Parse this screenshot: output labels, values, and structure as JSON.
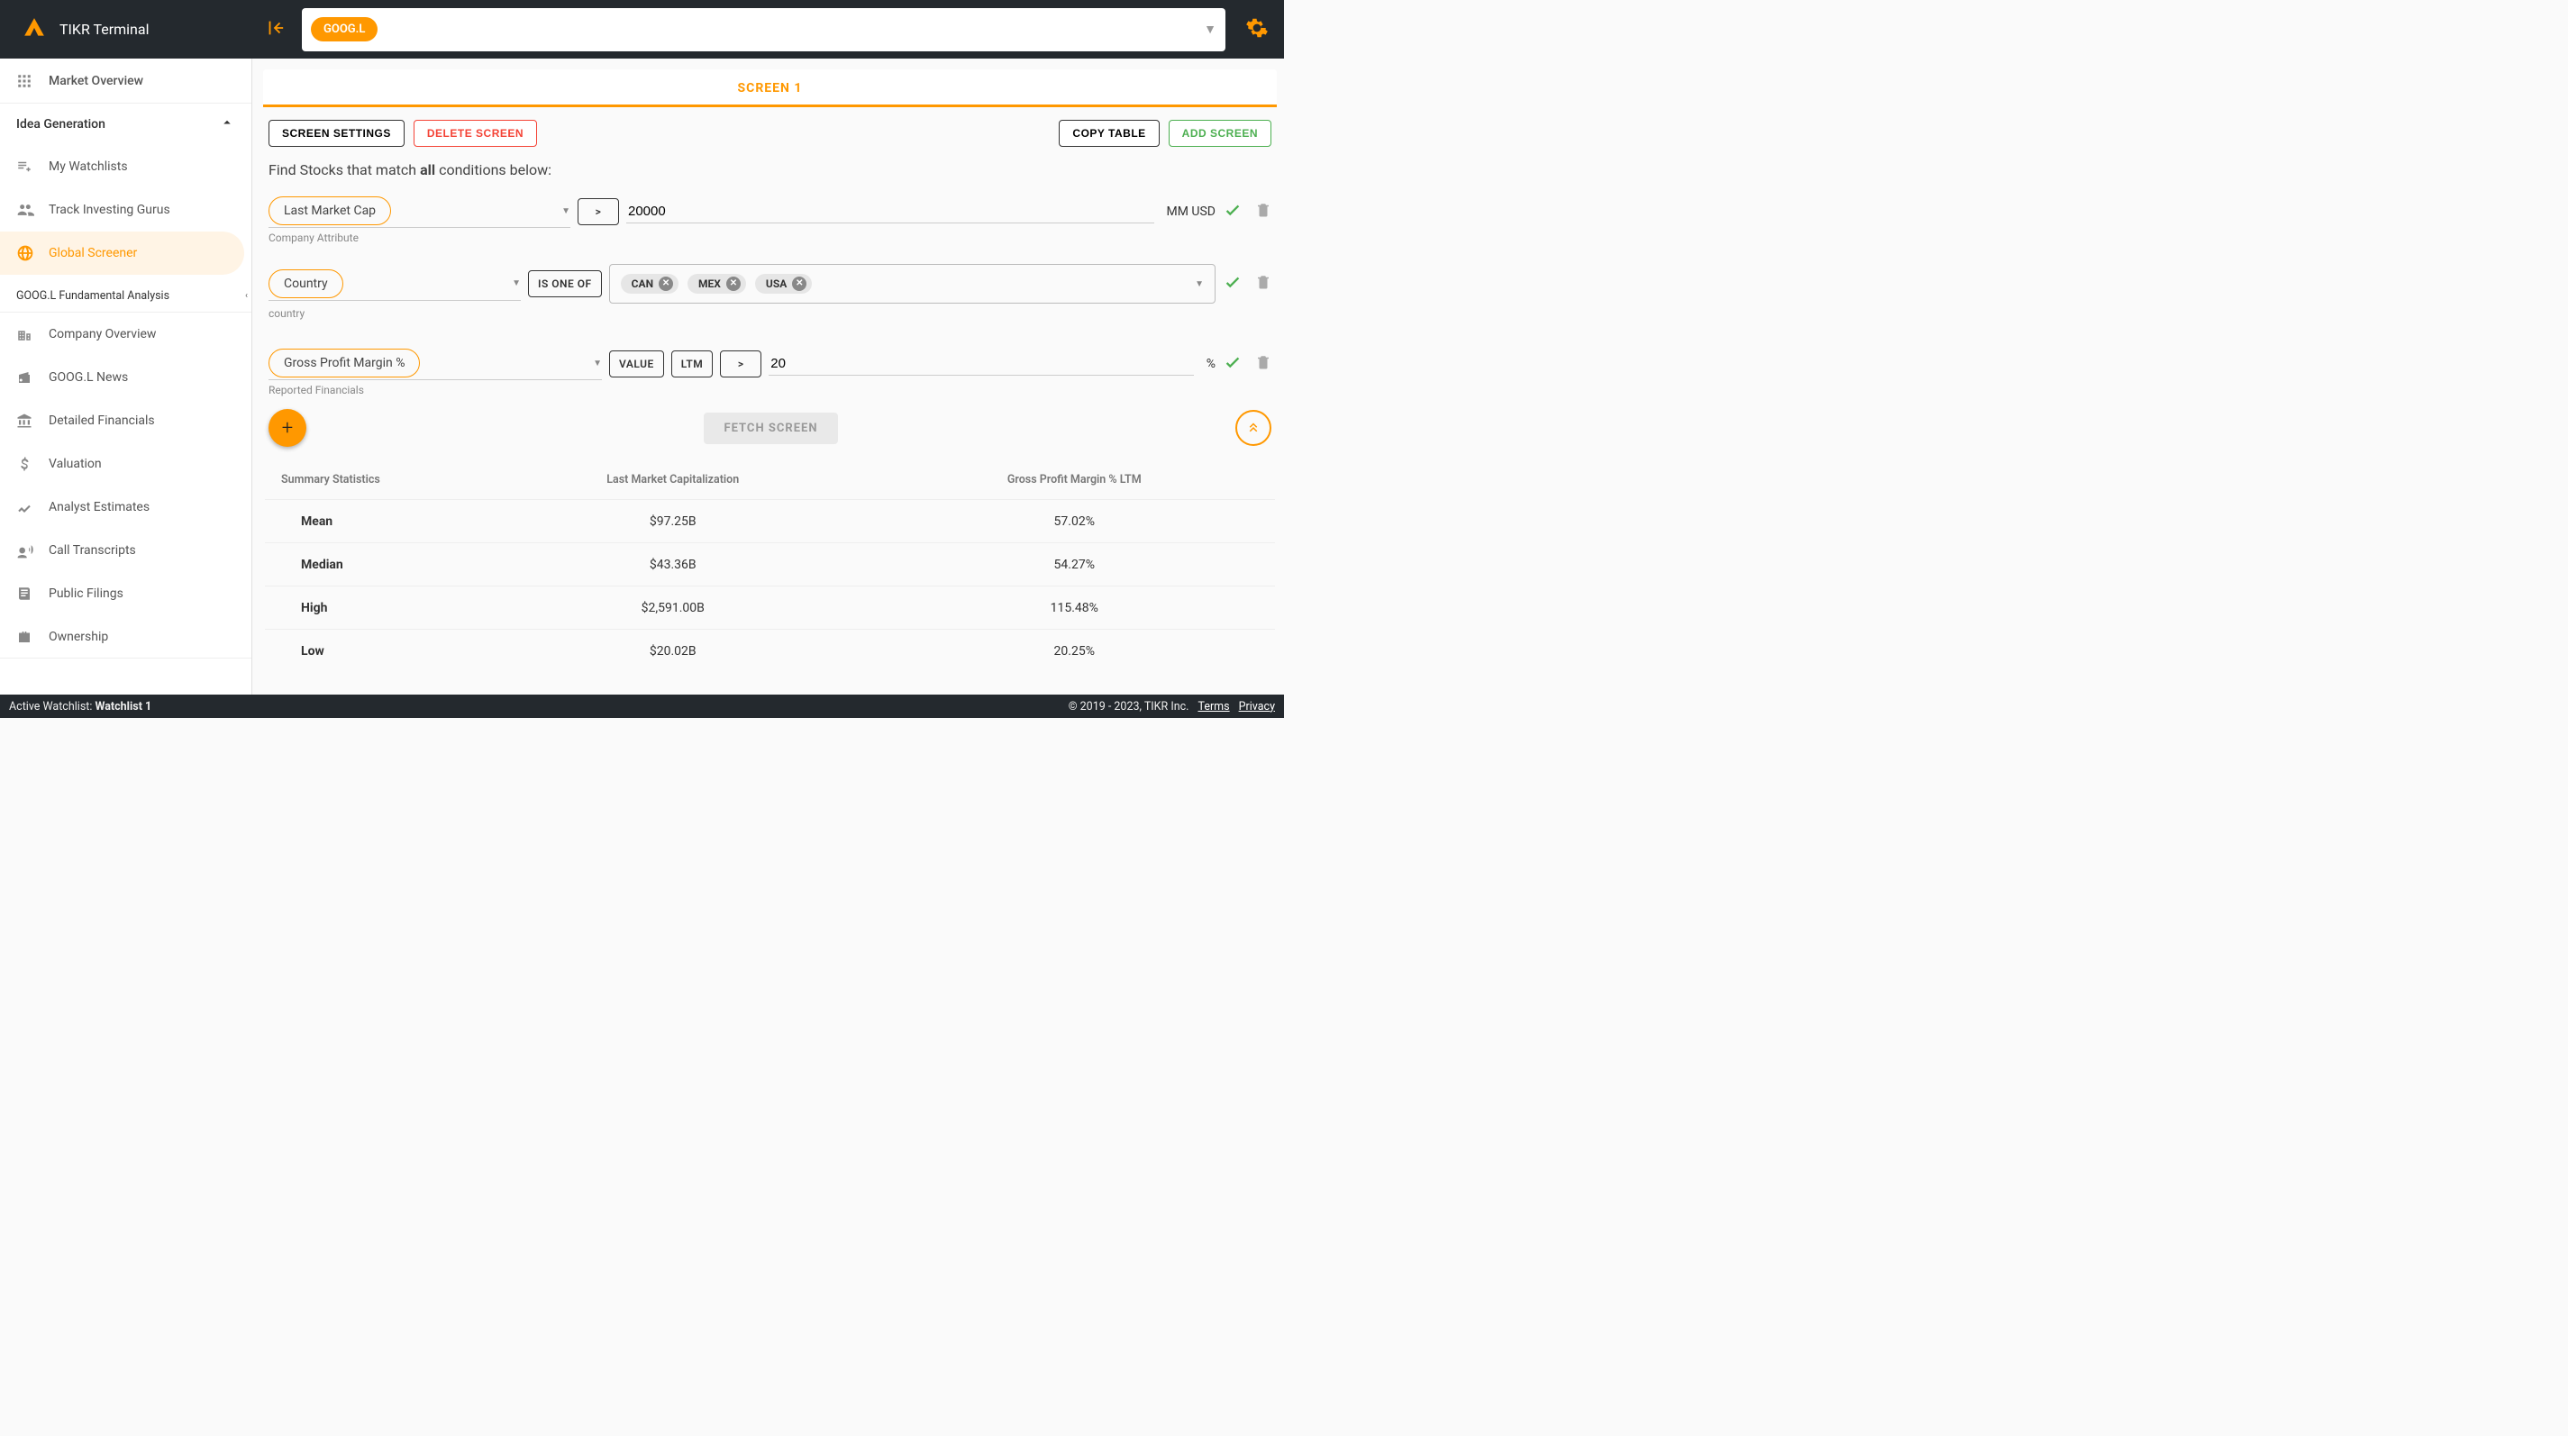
{
  "app": {
    "title": "TIKR Terminal"
  },
  "search": {
    "selected_ticker": "GOOG.L"
  },
  "sidebar": {
    "market_overview": "Market Overview",
    "idea_generation": "Idea Generation",
    "my_watchlists": "My Watchlists",
    "track_gurus": "Track Investing Gurus",
    "global_screener": "Global Screener",
    "fundamental": "GOOG.L Fundamental Analysis",
    "company_overview": "Company Overview",
    "news": "GOOG.L News",
    "detailed_financials": "Detailed Financials",
    "valuation": "Valuation",
    "analyst_estimates": "Analyst Estimates",
    "call_transcripts": "Call Transcripts",
    "public_filings": "Public Filings",
    "ownership": "Ownership"
  },
  "tabs": {
    "screen1": "SCREEN 1"
  },
  "toolbar": {
    "settings": "SCREEN SETTINGS",
    "delete": "DELETE SCREEN",
    "copy": "COPY TABLE",
    "add": "ADD SCREEN"
  },
  "instruction": {
    "pre": "Find Stocks that match ",
    "bold": "all",
    "post": " conditions below:"
  },
  "conditions": [
    {
      "attribute": "Last Market Cap",
      "category": "Company Attribute",
      "operator": ">",
      "value": "20000",
      "unit": "MM USD"
    },
    {
      "attribute": "Country",
      "category": "country",
      "operator": "IS ONE OF",
      "tags": [
        "CAN",
        "MEX",
        "USA"
      ]
    },
    {
      "attribute": "Gross Profit Margin %",
      "category": "Reported Financials",
      "tag1": "VALUE",
      "tag2": "LTM",
      "operator": ">",
      "value": "20",
      "unit": "%"
    }
  ],
  "fetch_label": "FETCH SCREEN",
  "stats": {
    "header": {
      "label": "Summary Statistics",
      "c2": "Last Market Capitalization",
      "c3": "Gross Profit Margin % LTM"
    },
    "rows": [
      {
        "label": "Mean",
        "c2": "$97.25B",
        "c3": "57.02%"
      },
      {
        "label": "Median",
        "c2": "$43.36B",
        "c3": "54.27%"
      },
      {
        "label": "High",
        "c2": "$2,591.00B",
        "c3": "115.48%"
      },
      {
        "label": "Low",
        "c2": "$20.02B",
        "c3": "20.25%"
      }
    ]
  },
  "footer": {
    "watchlist_pre": "Active Watchlist: ",
    "watchlist": "Watchlist 1",
    "copyright": "© 2019 - 2023, TIKR Inc.",
    "terms": "Terms",
    "privacy": "Privacy"
  }
}
